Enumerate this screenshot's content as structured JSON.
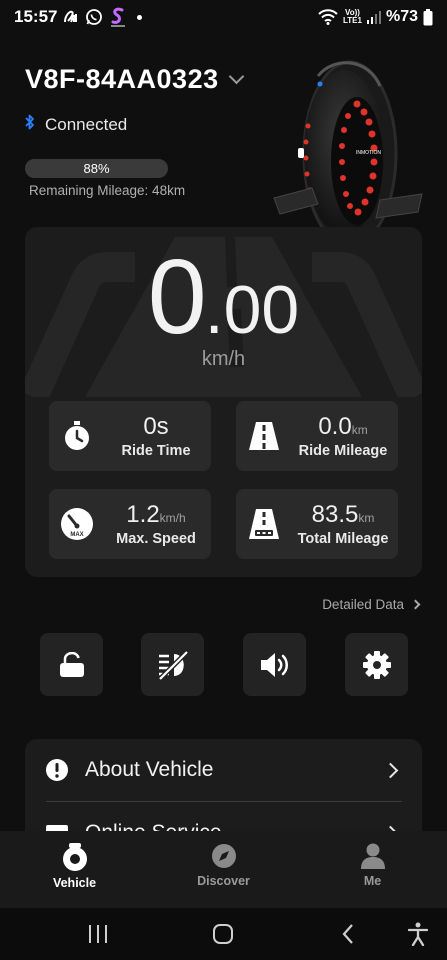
{
  "status_bar": {
    "time": "15:57",
    "battery": "%73",
    "network": "LTE1",
    "volte": "Vo))"
  },
  "device": {
    "name": "V8F-84AA0323",
    "connection_status": "Connected",
    "battery_percent": 88,
    "battery_label": "88%",
    "remaining_mileage": "Remaining Mileage: 48km",
    "brand_text": "INMOTION"
  },
  "speed": {
    "integer": "0",
    "decimal": ".00",
    "unit": "km/h"
  },
  "stats": {
    "ride_time": {
      "value": "0s",
      "unit": "",
      "label": "Ride Time",
      "icon": "stopwatch-icon"
    },
    "ride_mileage": {
      "value": "0.0",
      "unit": "km",
      "label": "Ride Mileage",
      "icon": "road-icon"
    },
    "max_speed": {
      "value": "1.2",
      "unit": "km/h",
      "label": "Max. Speed",
      "icon": "speedometer-icon",
      "badge": "MAX"
    },
    "total_mileage": {
      "value": "83.5",
      "unit": "km",
      "label": "Total Mileage",
      "icon": "road-odometer-icon"
    }
  },
  "detail_link": "Detailed Data",
  "controls": [
    {
      "name": "lock-button",
      "icon": "unlock-icon"
    },
    {
      "name": "headlight-button",
      "icon": "headlight-off-icon"
    },
    {
      "name": "sound-button",
      "icon": "speaker-icon"
    },
    {
      "name": "settings-button",
      "icon": "gear-icon"
    }
  ],
  "menu": {
    "about_vehicle": "About Vehicle",
    "online_service": "Online Service"
  },
  "bottom_nav": {
    "vehicle": "Vehicle",
    "discover": "Discover",
    "me": "Me"
  },
  "colors": {
    "background": "#0f0f0f",
    "card": "#1c1c1c",
    "tile": "#2a2a2a",
    "bluetooth": "#2a7fff",
    "wheel_accent": "#e0342b"
  }
}
